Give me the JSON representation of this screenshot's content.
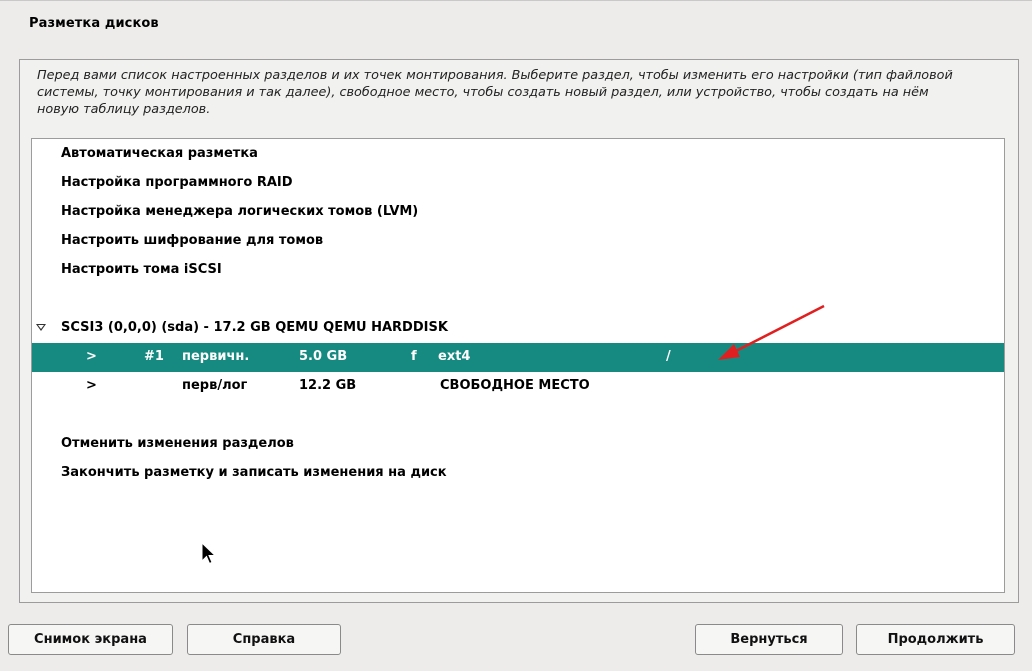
{
  "title": "Разметка дисков",
  "intro": "Перед вами список настроенных разделов и их точек монтирования. Выберите раздел, чтобы изменить его настройки (тип файловой системы, точку монтирования и так далее), свободное место, чтобы создать новый раздел, или устройство, чтобы создать на нём новую таблицу разделов.",
  "menu": {
    "auto": "Автоматическая разметка",
    "raid": "Настройка программного RAID",
    "lvm": "Настройка менеджера логических томов (LVM)",
    "crypto": "Настроить шифрование для томов",
    "iscsi": "Настроить тома iSCSI"
  },
  "disk": {
    "label": "SCSI3 (0,0,0) (sda) - 17.2 GB QEMU QEMU HARDDISK",
    "partitions": [
      {
        "arrow": ">",
        "number": "#1",
        "type": "первичн.",
        "size": "5.0 GB",
        "flag": "f",
        "fs": "ext4",
        "mount": "/"
      },
      {
        "arrow": ">",
        "number": "",
        "type": "перв/лог",
        "size": "12.2 GB",
        "flag": "",
        "fs": "СВОБОДНОЕ МЕСТО",
        "mount": ""
      }
    ]
  },
  "actions": {
    "undo": "Отменить изменения разделов",
    "finish": "Закончить разметку и записать изменения на диск"
  },
  "buttons": {
    "screenshot": "Снимок экрана",
    "help": "Справка",
    "back": "Вернуться",
    "continue": "Продолжить"
  },
  "colors": {
    "selection": "#168a80",
    "annotation_arrow": "#e02020"
  },
  "icons": {
    "expander": "triangle-down-icon",
    "cursor": "mouse-pointer-icon",
    "annotation": "red-arrow-annotation"
  }
}
